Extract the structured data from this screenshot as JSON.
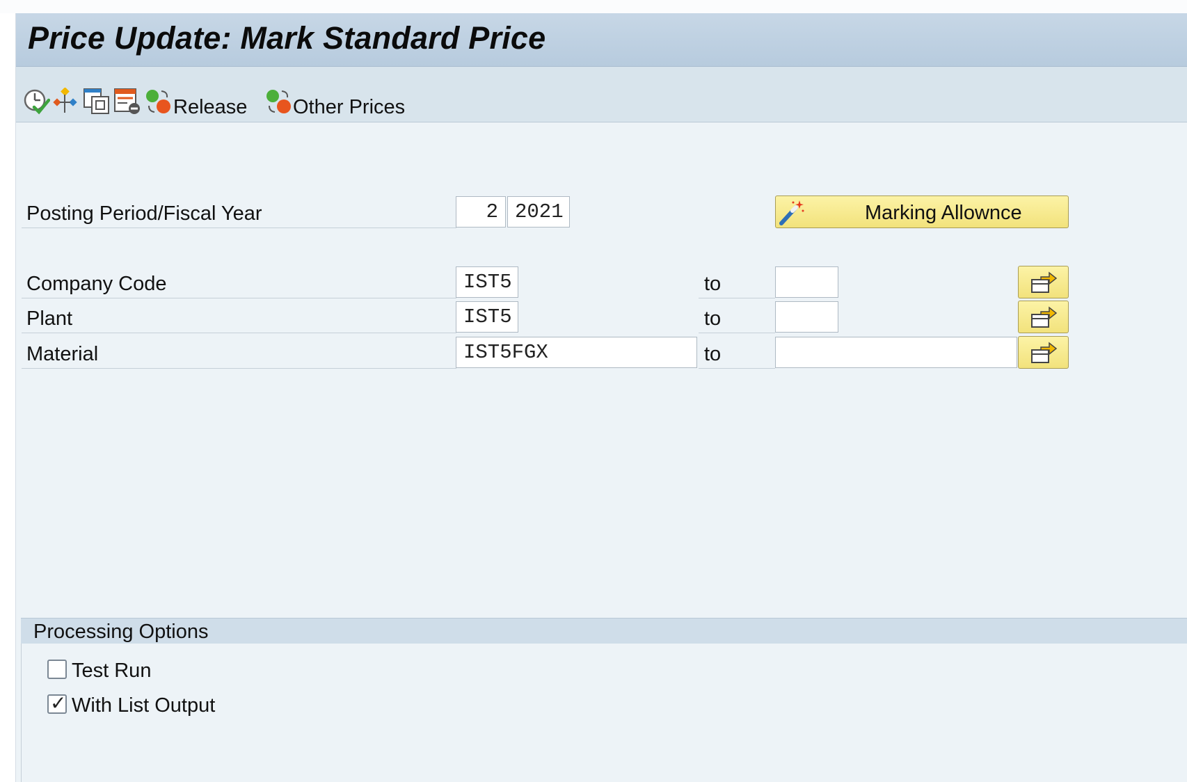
{
  "window": {
    "title": "Price Update: Mark Standard Price"
  },
  "toolbar": {
    "icons": [
      "execute-clock-icon",
      "hierarchy-icon",
      "copy-windows-icon",
      "list-delete-icon",
      "release-status-icon",
      "other-prices-status-icon"
    ],
    "release_label": "Release",
    "other_prices_label": "Other Prices"
  },
  "form": {
    "posting_period_label": "Posting Period/Fiscal Year",
    "posting_period_value": "2",
    "fiscal_year_value": "2021",
    "marking_allowance_label": "Marking Allownce",
    "to_label": "to",
    "rows": [
      {
        "label": "Company Code",
        "from": "IST5",
        "to": ""
      },
      {
        "label": "Plant",
        "from": "IST5",
        "to": ""
      },
      {
        "label": "Material",
        "from": "IST5FGX",
        "to": ""
      }
    ]
  },
  "processing": {
    "title": "Processing Options",
    "options": [
      {
        "label": "Test Run",
        "checked": false
      },
      {
        "label": "With List Output",
        "checked": true
      }
    ]
  },
  "colors": {
    "title_bar": "#b7cbde",
    "toolbar": "#d8e4ec",
    "background": "#edf3f7",
    "button_yellow": "#f2e27c"
  }
}
